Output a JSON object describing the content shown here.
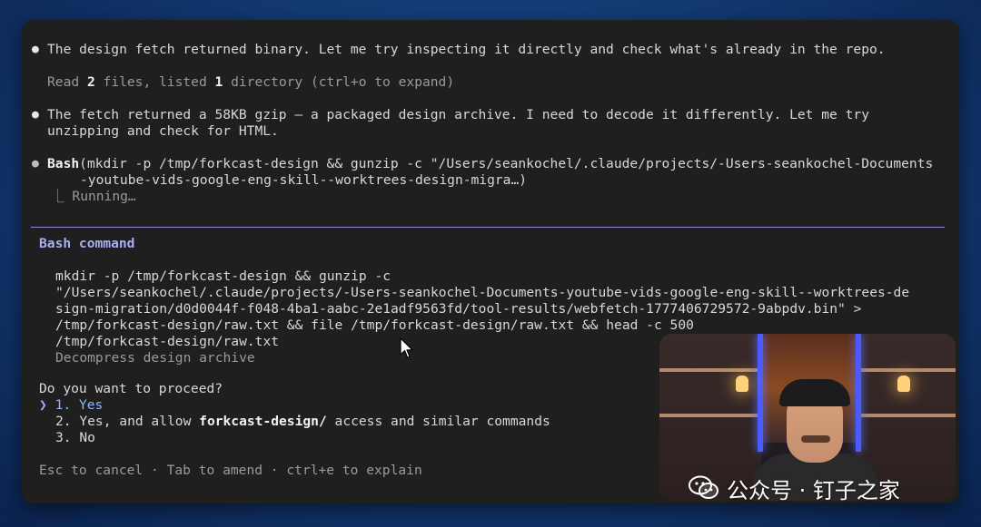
{
  "log": {
    "msg1": "The design fetch returned binary. Let me try inspecting it directly and check what's already in the repo.",
    "read_prefix": "Read ",
    "read_files_count": "2",
    "read_middle": " files, listed ",
    "read_dirs_count": "1",
    "read_suffix": " directory (ctrl+o to expand)",
    "msg2_line1": "The fetch returned a 58KB gzip — a packaged design archive. I need to decode it differently. Let me try",
    "msg2_line2": "unzipping and check for HTML.",
    "tool_name": "Bash",
    "tool_args_line1": "(mkdir -p /tmp/forkcast-design && gunzip -c \"/Users/seankochel/.claude/projects/-Users-seankochel-Documents",
    "tool_args_line2": "-youtube-vids-google-eng-skill--worktrees-design-migra…)",
    "status_prefix": "⎿",
    "status": "Running…"
  },
  "prompt": {
    "title": "Bash command",
    "command_lines": [
      "mkdir -p /tmp/forkcast-design && gunzip -c",
      "\"/Users/seankochel/.claude/projects/-Users-seankochel-Documents-youtube-vids-google-eng-skill--worktrees-de",
      "sign-migration/d0d0044f-f048-4ba1-aabc-2e1adf9563fd/tool-results/webfetch-1777406729572-9abpdv.bin\" >",
      "/tmp/forkcast-design/raw.txt && file /tmp/forkcast-design/raw.txt && head -c 500",
      "/tmp/forkcast-design/raw.txt"
    ],
    "description": "Decompress design archive",
    "question": "Do you want to proceed?",
    "selector": "❯",
    "options": {
      "yes": "1. Yes",
      "allow_prefix": "2. Yes, and allow ",
      "allow_bold": "forkcast-design/",
      "allow_suffix": " access and similar commands",
      "no": "3. No"
    },
    "footer": "Esc to cancel · Tab to amend · ctrl+e to explain"
  },
  "watermark": {
    "text": "公众号 · 钉子之家"
  },
  "colors": {
    "terminal_bg": "#1f1f1f",
    "divider": "#8b8dd8",
    "title": "#a9aef5",
    "selected": "#8fb6ff",
    "desktop": "#143e78"
  }
}
